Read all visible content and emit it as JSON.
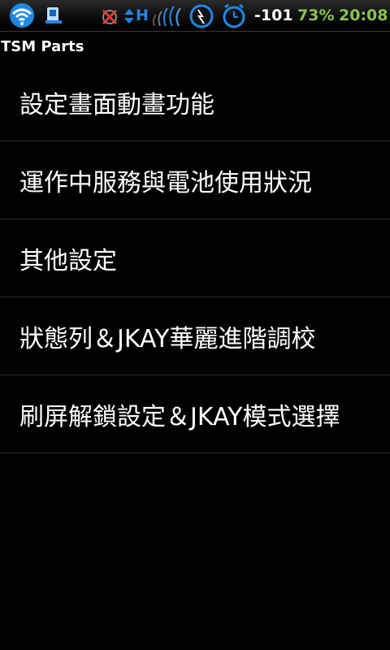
{
  "status_bar": {
    "icons": [
      "wifi-icon",
      "usb-icon",
      "sync-off-icon",
      "data-arrows-icon",
      "hspa-icon",
      "signal-waves-icon",
      "charging-icon",
      "alarm-icon"
    ],
    "hspa_label": "H",
    "signal": "-101",
    "battery": "73%",
    "clock": "20:08",
    "colors": {
      "accent": "#1e88e5",
      "clock": "#8bc34a"
    }
  },
  "app": {
    "title": "TSM Parts"
  },
  "menu": {
    "items": [
      {
        "label": "設定畫面動畫功能"
      },
      {
        "label": "運作中服務與電池使用狀況"
      },
      {
        "label": "其他設定"
      },
      {
        "label": "狀態列＆JKAY華麗進階調校"
      },
      {
        "label": "刷屏解鎖設定＆JKAY模式選擇"
      }
    ]
  }
}
